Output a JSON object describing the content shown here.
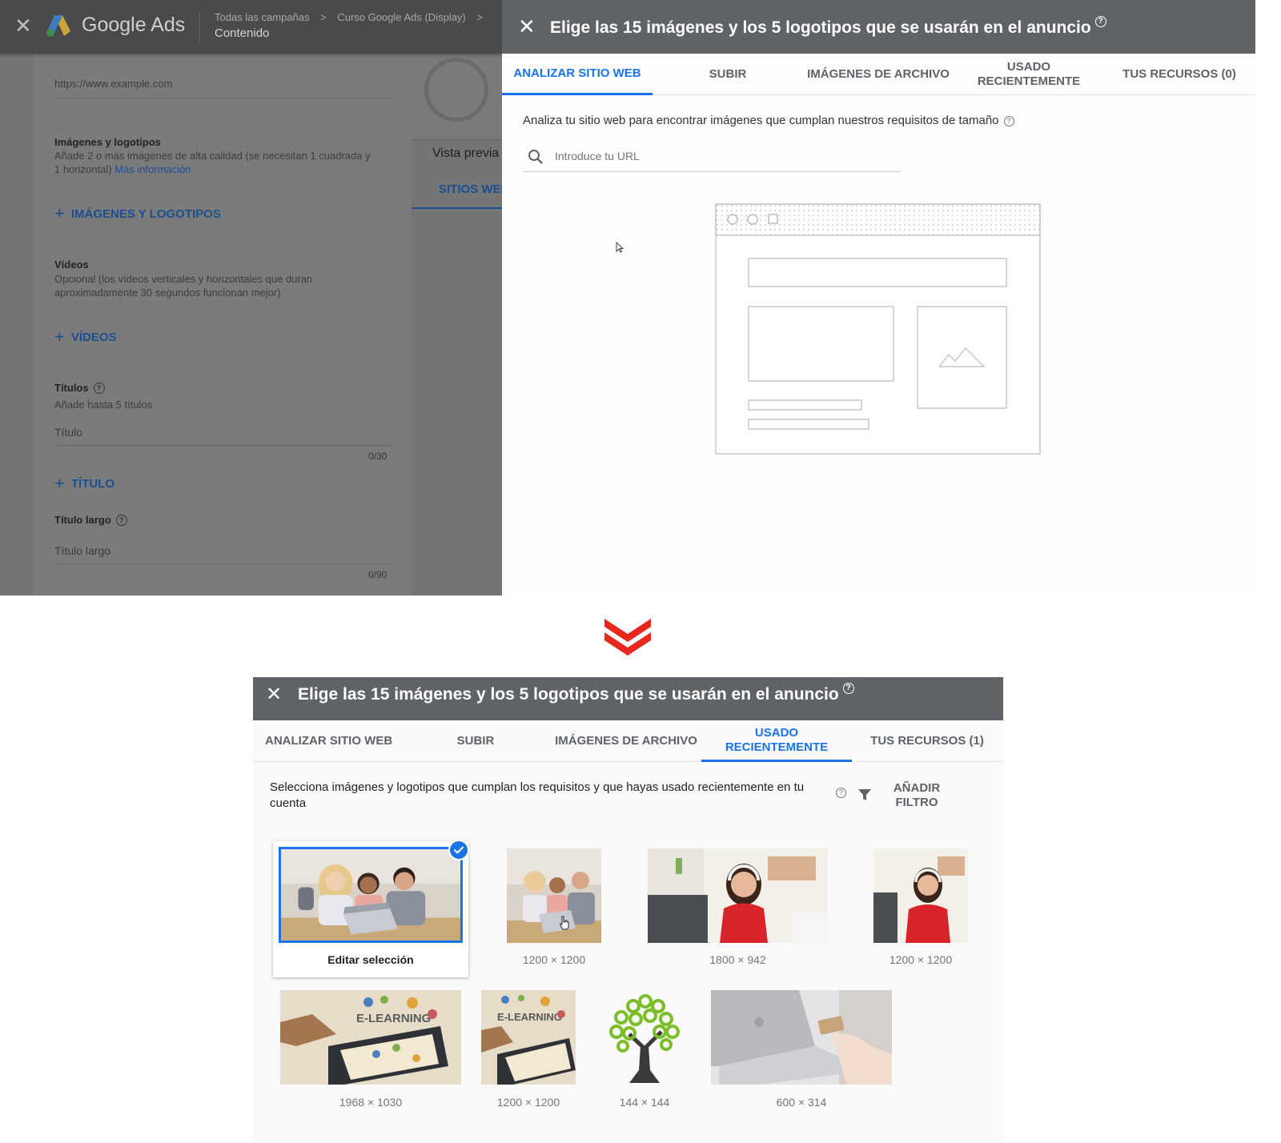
{
  "top": {
    "ads_bar": {
      "close": "✕",
      "app_name": "Google Ads",
      "breadcrumb": [
        "Todas las campañas",
        "Curso Google Ads (Display)"
      ],
      "breadcrumb_sep": ">",
      "page_title": "Contenido"
    },
    "form": {
      "url_value": "https://www.example.com",
      "images_heading": "Imágenes y logotipos",
      "images_help_1": "Añade 2 o más imágenes de alta calidad (se necesitan 1 cuadrada y",
      "images_help_2": "1 horizontal)",
      "images_more": "Más información",
      "add_images": "IMÁGENES Y LOGOTIPOS",
      "videos_heading": "Vídeos",
      "videos_help_1": "Opcional (los vídeos verticales y horizontales que duran",
      "videos_help_2": "aproximadamente 30 segundos funcionan mejor)",
      "add_videos": "VÍDEOS",
      "titles_heading": "Títulos",
      "titles_help": "Añade hasta 5 títulos",
      "title_placeholder": "Título",
      "title_count": "0/30",
      "add_title": "TÍTULO",
      "long_title_heading": "Título largo",
      "long_title_placeholder": "Título largo",
      "long_title_count": "0/90"
    },
    "preview": {
      "label": "Vista previa",
      "tab": "SITIOS WEB"
    },
    "dialog": {
      "close": "✕",
      "title": "Elige las 15 imágenes y los 5 logotipos que se usarán en el anuncio",
      "help": "?",
      "tabs": [
        "ANALIZAR SITIO WEB",
        "SUBIR",
        "IMÁGENES DE ARCHIVO",
        "USADO RECIENTEMENTE",
        "TUS RECURSOS (0)"
      ],
      "active_tab": "ANALIZAR SITIO WEB",
      "description": "Analiza tu sitio web para encontrar imágenes que cumplan nuestros requisitos de tamaño",
      "url_placeholder": "Introduce tu URL"
    }
  },
  "bottom": {
    "dialog": {
      "close": "✕",
      "title": "Elige las 15 imágenes y los 5 logotipos que se usarán en el anuncio",
      "help": "?",
      "tabs": [
        "ANALIZAR SITIO WEB",
        "SUBIR",
        "IMÁGENES DE ARCHIVO",
        "USADO RECIENTEMENTE",
        "TUS RECURSOS (1)"
      ],
      "active_tab": "USADO RECIENTEMENTE",
      "description": "Selecciona imágenes y logotipos que cumplan los requisitos y que hayas usado recientemente en tu cuenta",
      "filter_label": "AÑADIR FILTRO",
      "selected_label": "Editar selección",
      "images": [
        {
          "name": "students-laptop-wide",
          "size": "",
          "selected": true
        },
        {
          "name": "students-laptop-square",
          "size": "1200 × 1200",
          "selected": false
        },
        {
          "name": "woman-headphones-wide",
          "size": "1800 × 942",
          "selected": false
        },
        {
          "name": "woman-headphones-square",
          "size": "1200 × 1200",
          "selected": false
        },
        {
          "name": "elearning-wide",
          "size": "1968 × 1030",
          "selected": false,
          "text": "E-LEARNING"
        },
        {
          "name": "elearning-square",
          "size": "1200 × 1200",
          "selected": false,
          "text": "E-LEARNING"
        },
        {
          "name": "tree-logo",
          "size": "144 × 144",
          "selected": false
        },
        {
          "name": "laptop-card-payment",
          "size": "600 × 314",
          "selected": false
        }
      ]
    }
  },
  "colors": {
    "accent_blue": "#1a73e8",
    "dialog_header": "#5f6368",
    "arrow_red": "#e8281f"
  }
}
